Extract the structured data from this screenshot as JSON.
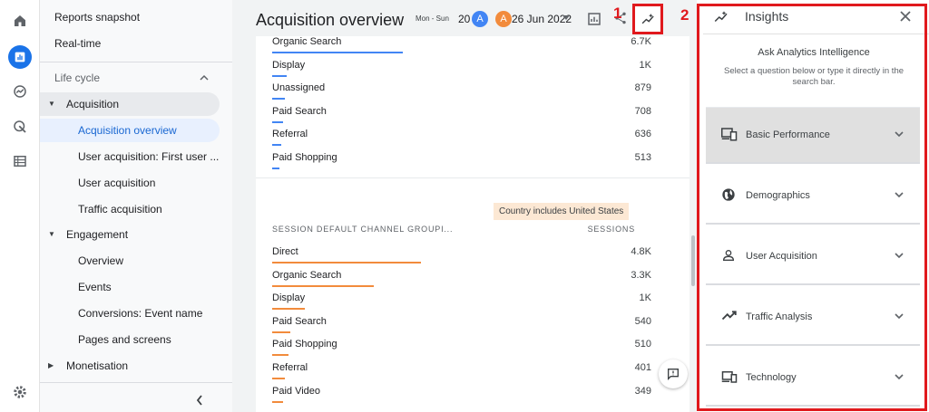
{
  "nav": {
    "reports_snapshot": "Reports snapshot",
    "realtime": "Real-time",
    "section": "Life cycle",
    "acquisition": "Acquisition",
    "acquisition_overview": "Acquisition overview",
    "user_acquisition_first": "User acquisition: First user ...",
    "user_acquisition": "User acquisition",
    "traffic_acquisition": "Traffic acquisition",
    "engagement": "Engagement",
    "overview": "Overview",
    "events": "Events",
    "conversions": "Conversions: Event name",
    "pages_screens": "Pages and screens",
    "monetisation": "Monetisation"
  },
  "header": {
    "title": "Acquisition overview",
    "date_small": "Mon - Sun",
    "date_prefix": "20",
    "date_suffix": "26 Jun 2022",
    "avatar_a": "A",
    "avatar_b": "A"
  },
  "annotations": {
    "one": "1",
    "two": "2"
  },
  "table1": {
    "rows": [
      {
        "label": "Organic Search",
        "value": "6.7K",
        "bar": 0.36
      },
      {
        "label": "Display",
        "value": "1K",
        "bar": 0.04
      },
      {
        "label": "Unassigned",
        "value": "879",
        "bar": 0.035
      },
      {
        "label": "Paid Search",
        "value": "708",
        "bar": 0.03
      },
      {
        "label": "Referral",
        "value": "636",
        "bar": 0.025
      },
      {
        "label": "Paid Shopping",
        "value": "513",
        "bar": 0.02
      }
    ]
  },
  "filter_chip": "Country includes United States",
  "table2": {
    "col1": "SESSION DEFAULT CHANNEL GROUPI...",
    "col2": "SESSIONS",
    "rows": [
      {
        "label": "Direct",
        "value": "4.8K",
        "bar": 0.41
      },
      {
        "label": "Organic Search",
        "value": "3.3K",
        "bar": 0.28
      },
      {
        "label": "Display",
        "value": "1K",
        "bar": 0.09
      },
      {
        "label": "Paid Search",
        "value": "540",
        "bar": 0.05
      },
      {
        "label": "Paid Shopping",
        "value": "510",
        "bar": 0.045
      },
      {
        "label": "Referral",
        "value": "401",
        "bar": 0.035
      },
      {
        "label": "Paid Video",
        "value": "349",
        "bar": 0.03
      }
    ]
  },
  "insights": {
    "title": "Insights",
    "heading": "Ask Analytics Intelligence",
    "subtext": "Select a question below or type it directly in the search bar.",
    "items": [
      {
        "label": "Basic Performance",
        "icon": "devices-icon"
      },
      {
        "label": "Demographics",
        "icon": "globe-icon"
      },
      {
        "label": "User Acquisition",
        "icon": "person-icon"
      },
      {
        "label": "Traffic Analysis",
        "icon": "trending-icon"
      },
      {
        "label": "Technology",
        "icon": "computer-phone-icon"
      }
    ]
  },
  "colors": {
    "blue_bar": "#4285f4",
    "orange_bar": "#f28b3c",
    "annotation_red": "#e0191d"
  }
}
